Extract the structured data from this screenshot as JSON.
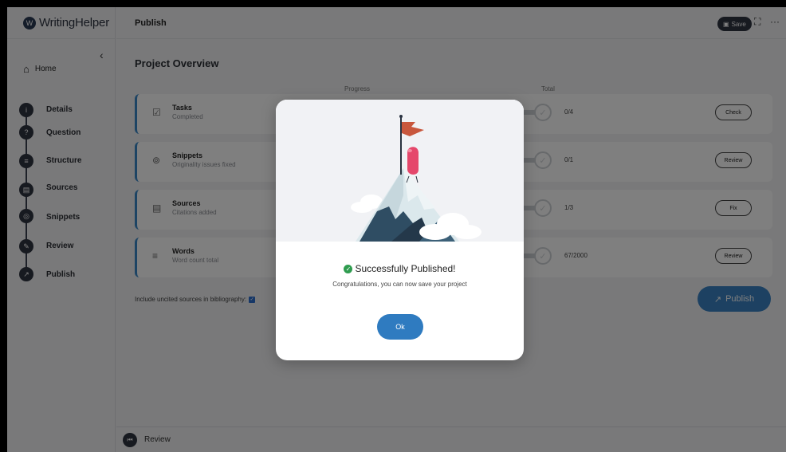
{
  "app": {
    "logo_mark": "W",
    "name": "WritingHelper"
  },
  "topbar": {
    "title": "Publish",
    "save_label": "Save",
    "save_icon": "save-icon",
    "expand_glyph": "⛶",
    "more_glyph": "···"
  },
  "sidebar": {
    "collapse_glyph": "‹",
    "home": {
      "label": "Home",
      "icon": "home-icon"
    },
    "steps": [
      {
        "label": "Details",
        "icon": "info-icon",
        "glyph": "i"
      },
      {
        "label": "Question",
        "icon": "speech-icon",
        "glyph": "?"
      },
      {
        "label": "Structure",
        "icon": "list-icon",
        "glyph": "≡"
      },
      {
        "label": "Sources",
        "icon": "book-icon",
        "glyph": "▤"
      },
      {
        "label": "Snippets",
        "icon": "snippet-icon",
        "glyph": "◎"
      },
      {
        "label": "Review",
        "icon": "review-icon",
        "glyph": "✎"
      },
      {
        "label": "Publish",
        "icon": "publish-icon",
        "glyph": "↗"
      }
    ]
  },
  "main": {
    "title": "Project Overview",
    "columns": {
      "progress": "Progress",
      "total": "Total"
    },
    "cards": [
      {
        "title": "Tasks",
        "subtitle": "Completed",
        "total": "0/4",
        "button": "Check",
        "icon": "checkbox-icon"
      },
      {
        "title": "Snippets",
        "subtitle": "Originality issues fixed",
        "total": "0/1",
        "button": "Review",
        "icon": "snippet-icon"
      },
      {
        "title": "Sources",
        "subtitle": "Citations added",
        "total": "1/3",
        "button": "Fix",
        "icon": "book-icon"
      },
      {
        "title": "Words",
        "subtitle": "Word count total",
        "total": "67/2000",
        "button": "Review",
        "icon": "lines-icon"
      }
    ],
    "uncited_label": "Include uncited sources in bibliography:",
    "uncited_checked": true,
    "publish_label": "Publish"
  },
  "bottombar": {
    "label": "Review",
    "icon": "previous-icon"
  },
  "modal": {
    "title": "Successfully Published!",
    "subtitle": "Congratulations, you can now save your project",
    "ok_label": "Ok",
    "colors": {
      "flag": "#c8573d",
      "balloon": "#e5476b",
      "mountain_dark": "#2f4d63",
      "snow": "#dbe8ec",
      "button": "#2f7bc0"
    }
  }
}
